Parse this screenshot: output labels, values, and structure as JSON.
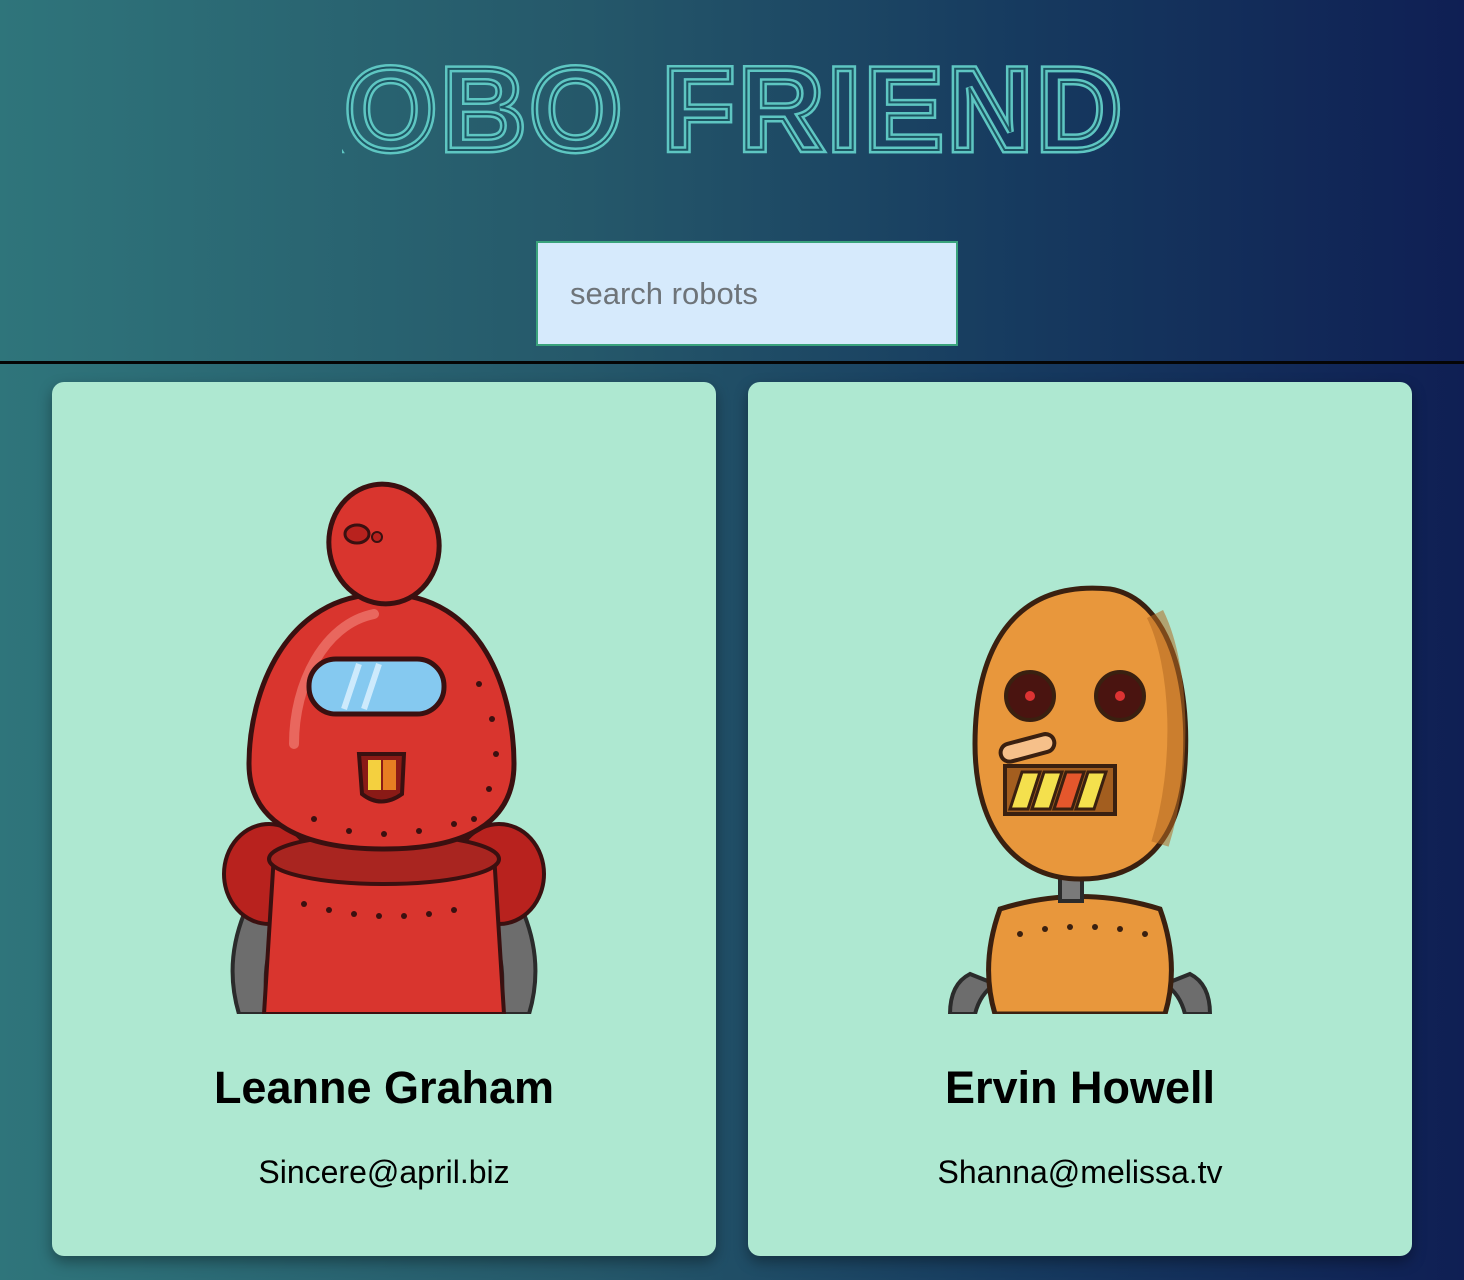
{
  "header": {
    "title": "ROBO FRIENDS",
    "title_color": "#5ec6c2",
    "search": {
      "placeholder": "search robots",
      "value": ""
    }
  },
  "robots": [
    {
      "name": "Leanne Graham",
      "email": "Sincere@april.biz",
      "avatar": "red-robot-icon",
      "color": "#d9352e"
    },
    {
      "name": "Ervin Howell",
      "email": "Shanna@melissa.tv",
      "avatar": "orange-robot-icon",
      "color": "#e8973c"
    }
  ],
  "colors": {
    "card_background": "#aee8d1",
    "search_background": "#d6eafc"
  }
}
